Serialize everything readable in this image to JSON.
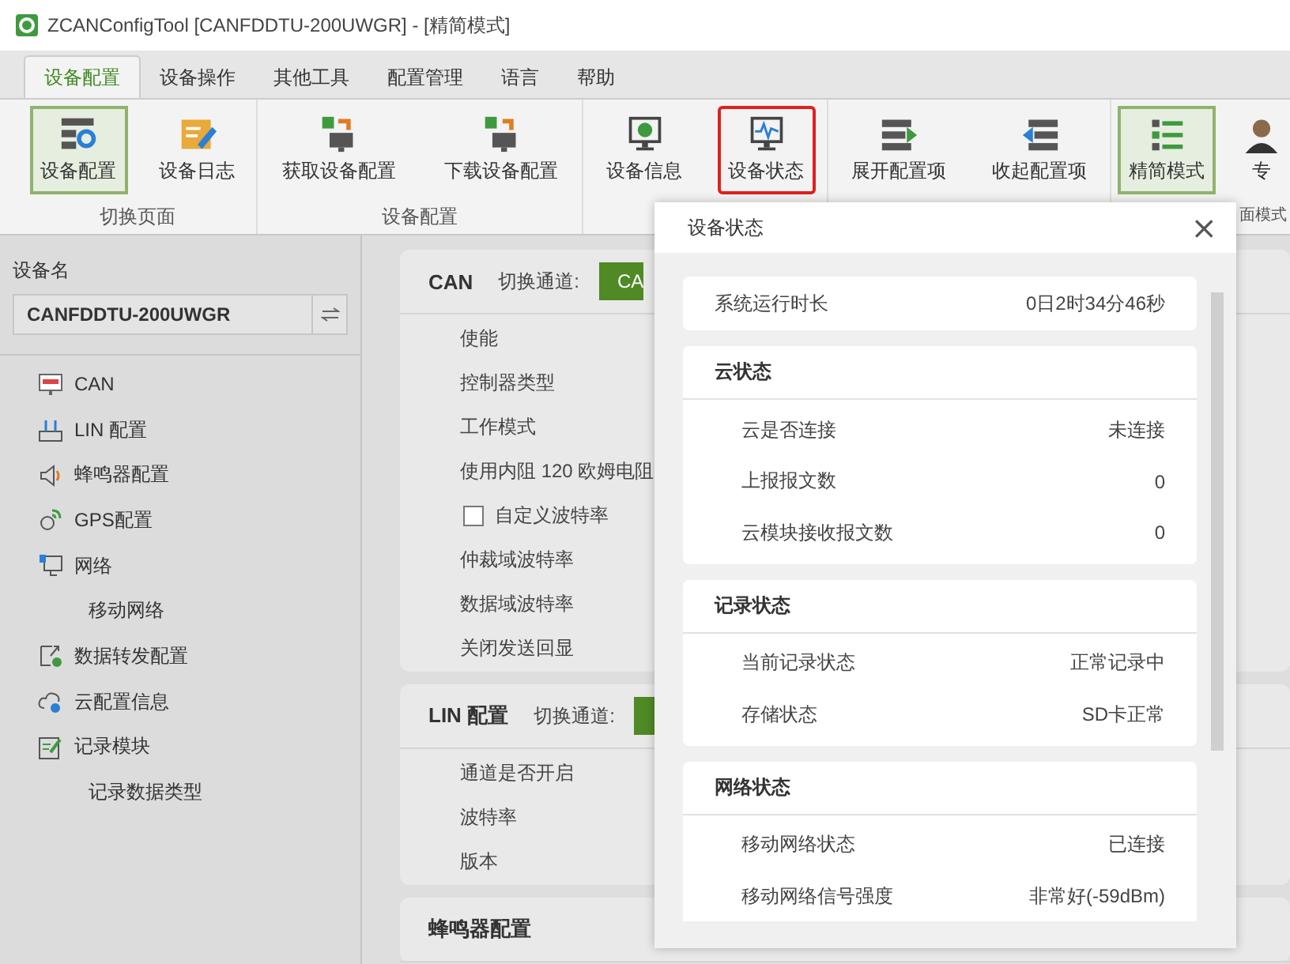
{
  "window": {
    "title": "ZCANConfigTool [CANFDDTU-200UWGR] - [精简模式]"
  },
  "menu_tabs": [
    {
      "label": "设备配置",
      "selected": true
    },
    {
      "label": "设备操作",
      "selected": false
    },
    {
      "label": "其他工具",
      "selected": false
    },
    {
      "label": "配置管理",
      "selected": false
    },
    {
      "label": "语言",
      "selected": false
    },
    {
      "label": "帮助",
      "selected": false
    }
  ],
  "ribbon": {
    "groups": [
      {
        "label": "切换页面",
        "buttons": [
          {
            "label": "设备配置",
            "kind": "settings",
            "selected": true,
            "highlighted": false
          },
          {
            "label": "设备日志",
            "kind": "log",
            "selected": false,
            "highlighted": false
          }
        ]
      },
      {
        "label": "设备配置",
        "buttons": [
          {
            "label": "获取设备配置",
            "kind": "fetch",
            "selected": false,
            "highlighted": false
          },
          {
            "label": "下载设备配置",
            "kind": "upload",
            "selected": false,
            "highlighted": false
          }
        ]
      },
      {
        "buttons": [
          {
            "label": "设备信息",
            "kind": "info",
            "selected": false,
            "highlighted": false
          },
          {
            "label": "设备状态",
            "kind": "monitor",
            "selected": false,
            "highlighted": true
          }
        ]
      },
      {
        "buttons": [
          {
            "label": "展开配置项",
            "kind": "expand",
            "selected": false,
            "highlighted": false
          },
          {
            "label": "收起配置项",
            "kind": "collapse",
            "selected": false,
            "highlighted": false
          }
        ]
      },
      {
        "label": "面模式",
        "buttons": [
          {
            "label": "精简模式",
            "kind": "list",
            "selected": true,
            "highlighted": false
          },
          {
            "label": "专",
            "kind": "person",
            "selected": false,
            "highlighted": false
          }
        ]
      }
    ]
  },
  "sidebar": {
    "device_label": "设备名",
    "device_name": "CANFDDTU-200UWGR",
    "items": [
      {
        "label": "CAN",
        "kind": "can"
      },
      {
        "label": "LIN 配置",
        "kind": "lin"
      },
      {
        "label": "蜂鸣器配置",
        "kind": "buzzer"
      },
      {
        "label": "GPS配置",
        "kind": "gps"
      },
      {
        "label": "网络",
        "kind": "network",
        "children": [
          {
            "label": "移动网络"
          }
        ]
      },
      {
        "label": "数据转发配置",
        "kind": "forward"
      },
      {
        "label": "云配置信息",
        "kind": "cloud"
      },
      {
        "label": "记录模块",
        "kind": "record",
        "children": [
          {
            "label": "记录数据类型"
          }
        ]
      }
    ]
  },
  "sections": [
    {
      "title": "CAN",
      "switch_label": "切换通道:",
      "channel_button": "CA",
      "rows": [
        {
          "label": "使能",
          "kind": "text"
        },
        {
          "label": "控制器类型",
          "kind": "text"
        },
        {
          "label": "工作模式",
          "kind": "text"
        },
        {
          "label": "使用内阻 120 欧姆电阻",
          "kind": "text"
        },
        {
          "label": "自定义波特率",
          "kind": "checkbox",
          "checked": false
        },
        {
          "label": "仲裁域波特率",
          "kind": "text"
        },
        {
          "label": "数据域波特率",
          "kind": "text"
        },
        {
          "label": "关闭发送回显",
          "kind": "text"
        }
      ]
    },
    {
      "title": "LIN 配置",
      "switch_label": "切换通道:",
      "rows": [
        {
          "label": "通道是否开启",
          "kind": "text"
        },
        {
          "label": "波特率",
          "kind": "text"
        },
        {
          "label": "版本",
          "kind": "text"
        }
      ]
    },
    {
      "title": "蜂鸣器配置"
    }
  ],
  "dialog": {
    "title": "设备状态",
    "close": "×",
    "groups": [
      {
        "kind": "single",
        "rows": [
          {
            "label": "系统运行时长",
            "value": "0日2时34分46秒"
          }
        ]
      },
      {
        "kind": "group",
        "title": "云状态",
        "rows": [
          {
            "label": "云是否连接",
            "value": "未连接"
          },
          {
            "label": "上报报文数",
            "value": "0"
          },
          {
            "label": "云模块接收报文数",
            "value": "0"
          }
        ]
      },
      {
        "kind": "group",
        "title": "记录状态",
        "rows": [
          {
            "label": "当前记录状态",
            "value": "正常记录中"
          },
          {
            "label": "存储状态",
            "value": "SD卡正常"
          }
        ]
      },
      {
        "kind": "group",
        "title": "网络状态",
        "rows": [
          {
            "label": "移动网络状态",
            "value": "已连接"
          },
          {
            "label": "移动网络信号强度",
            "value": "非常好(-59dBm)"
          }
        ]
      }
    ]
  }
}
